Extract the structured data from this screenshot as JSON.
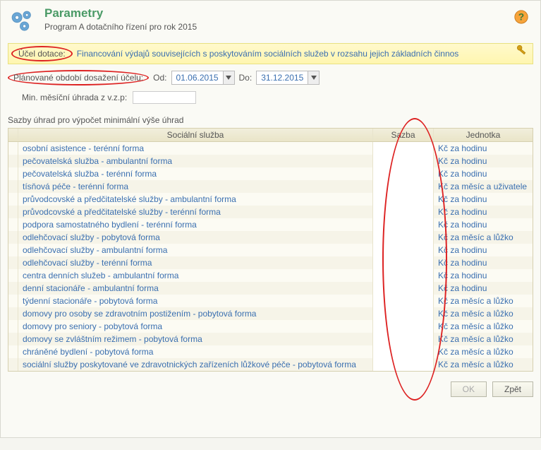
{
  "header": {
    "title": "Parametry",
    "subtitle": "Program A dotačního řízení pro rok 2015"
  },
  "purpose": {
    "label": "Účel dotace:",
    "value": "Financování výdajů souvisejících s poskytováním sociálních služeb v rozsahu jejich základních činnos"
  },
  "period": {
    "label": "Plánované období dosažení účelu:",
    "from_label": "Od:",
    "from_value": "01.06.2015",
    "to_label": "Do:",
    "to_value": "31.12.2015"
  },
  "min_fee": {
    "label": "Min. měsíční úhrada z v.z.p:",
    "value": ""
  },
  "table": {
    "caption": "Sazby úhrad pro výpočet minimální výše úhrad",
    "columns": {
      "service": "Sociální služba",
      "rate": "Sazba",
      "unit": "Jednotka"
    },
    "rows": [
      {
        "service": "osobní asistence - terénní forma",
        "rate": "",
        "unit": "Kč za hodinu"
      },
      {
        "service": "pečovatelská služba - ambulantní forma",
        "rate": "",
        "unit": "Kč za hodinu"
      },
      {
        "service": "pečovatelská služba - terénní forma",
        "rate": "",
        "unit": "Kč za hodinu"
      },
      {
        "service": "tísňová péče - terénní forma",
        "rate": "",
        "unit": "Kč za měsíc a uživatele"
      },
      {
        "service": "průvodcovské a předčitatelské služby - ambulantní forma",
        "rate": "",
        "unit": "Kč za hodinu"
      },
      {
        "service": "průvodcovské a předčitatelské služby - terénní forma",
        "rate": "",
        "unit": "Kč za hodinu"
      },
      {
        "service": "podpora samostatného bydlení - terénní forma",
        "rate": "",
        "unit": "Kč za hodinu"
      },
      {
        "service": "odlehčovací služby - pobytová forma",
        "rate": "",
        "unit": "Kč za měsíc a lůžko"
      },
      {
        "service": "odlehčovací služby - ambulantní forma",
        "rate": "",
        "unit": "Kč za hodinu"
      },
      {
        "service": "odlehčovací služby - terénní forma",
        "rate": "",
        "unit": "Kč za hodinu"
      },
      {
        "service": "centra denních služeb - ambulantní forma",
        "rate": "",
        "unit": "Kč za hodinu"
      },
      {
        "service": "denní stacionáře - ambulantní forma",
        "rate": "",
        "unit": "Kč za hodinu"
      },
      {
        "service": "týdenní stacionáře - pobytová forma",
        "rate": "",
        "unit": "Kč za měsíc a lůžko"
      },
      {
        "service": "domovy pro osoby se zdravotním postižením - pobytová forma",
        "rate": "",
        "unit": "Kč za měsíc a lůžko"
      },
      {
        "service": "domovy pro seniory - pobytová forma",
        "rate": "",
        "unit": "Kč za měsíc a lůžko"
      },
      {
        "service": "domovy se zvláštním režimem - pobytová forma",
        "rate": "",
        "unit": "Kč za měsíc a lůžko"
      },
      {
        "service": "chráněné bydlení - pobytová forma",
        "rate": "",
        "unit": "Kč za měsíc a lůžko"
      },
      {
        "service": "sociální služby poskytované ve zdravotnických zařízeních lůžkové péče - pobytová forma",
        "rate": "",
        "unit": "Kč za měsíc a lůžko"
      }
    ]
  },
  "footer": {
    "ok": "OK",
    "back": "Zpět"
  }
}
